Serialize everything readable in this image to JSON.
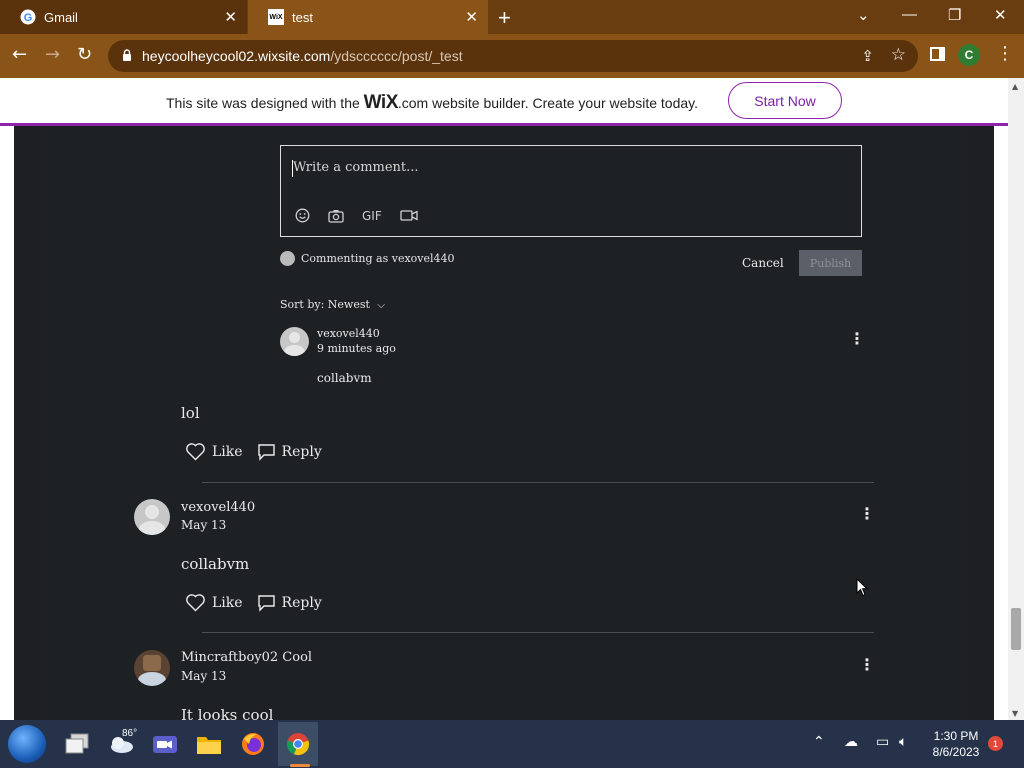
{
  "browser": {
    "tabs": [
      {
        "title": "Gmail",
        "icon": "google-icon",
        "active": false
      },
      {
        "title": "test",
        "icon": "wix-icon",
        "active": true
      }
    ],
    "url_host": "heycoolheycool02.wixsite.com",
    "url_path": "/ydscccccc/post/_test",
    "profile_initial": "C",
    "tab_favicon_wix": "WiX",
    "accent": "#8a5418"
  },
  "wix_banner": {
    "text_before": "This site was designed with the",
    "logo": "WiX",
    "text_after": ".com website builder. Create your website today.",
    "button": "Start Now",
    "accent": "#8e24aa"
  },
  "composer": {
    "placeholder": "Write a comment...",
    "gif_label": "GIF",
    "commenting_as": "Commenting as vexovel440",
    "cancel": "Cancel",
    "publish": "Publish"
  },
  "sort": {
    "label": "Sort by: Newest"
  },
  "reply": {
    "author": "vexovel440",
    "time": "9 minutes ago",
    "text": "collabvm"
  },
  "comments": [
    {
      "text": "lol",
      "like_label": "Like",
      "reply_label": "Reply"
    },
    {
      "author": "vexovel440",
      "time": "May 13",
      "text": "collabvm",
      "like_label": "Like",
      "reply_label": "Reply"
    },
    {
      "author": "Mincraftboy02 Cool",
      "time": "May 13",
      "text": "It looks cool"
    }
  ],
  "taskbar": {
    "weather_temp": "86°",
    "time": "1:30 PM",
    "date": "8/6/2023",
    "notification_count": "1"
  }
}
